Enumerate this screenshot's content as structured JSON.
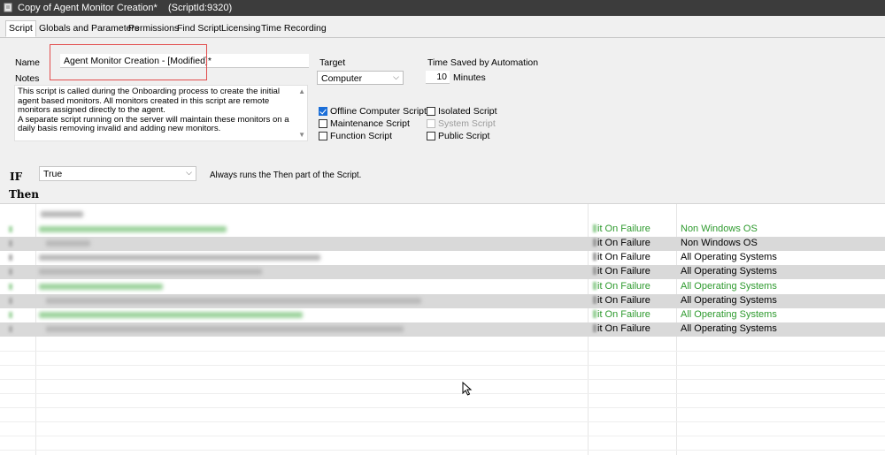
{
  "window": {
    "title": "Copy of Agent Monitor Creation*",
    "script_id": "(ScriptId:9320)"
  },
  "tabs": [
    "Script",
    "Globals and Parameters",
    "Permissions",
    "Find Script",
    "Licensing",
    "Time Recording"
  ],
  "form": {
    "name_label": "Name",
    "name_value": "Agent Monitor Creation - [Modified]*",
    "notes_label": "Notes",
    "notes_value": "This script is called during the Onboarding process to create the initial agent based monitors.  All monitors created in this script are remote monitors assigned directly to the agent.\nA separate script running on the server will maintain these monitors on a daily basis removing invalid and adding new monitors.",
    "target_label": "Target",
    "target_value": "Computer",
    "time_saved_label": "Time Saved by Automation",
    "time_saved_value": "10",
    "time_saved_unit": "Minutes",
    "checkboxes": {
      "offline_computer_script": {
        "label": "Offline Computer Script",
        "checked": true
      },
      "maintenance_script": {
        "label": "Maintenance Script",
        "checked": false
      },
      "function_script": {
        "label": "Function Script",
        "checked": false
      },
      "isolated_script": {
        "label": "Isolated Script",
        "checked": false
      },
      "system_script": {
        "label": "System Script",
        "checked": false,
        "disabled": true
      },
      "public_script": {
        "label": "Public Script",
        "checked": false
      }
    }
  },
  "if_section": {
    "if_label": "IF",
    "condition_value": "True",
    "condition_description": "Always runs the Then part of the Script.",
    "then_label": "Then"
  },
  "steps": [
    {
      "on_failure": "it On Failure",
      "os": "Non Windows OS",
      "color": "green"
    },
    {
      "on_failure": "it On Failure",
      "os": "Non Windows OS",
      "color": "gray"
    },
    {
      "on_failure": "it On Failure",
      "os": "All Operating Systems",
      "color": "normal"
    },
    {
      "on_failure": "it On Failure",
      "os": "All Operating Systems",
      "color": "gray"
    },
    {
      "on_failure": "it On Failure",
      "os": "All Operating Systems",
      "color": "green"
    },
    {
      "on_failure": "it On Failure",
      "os": "All Operating Systems",
      "color": "gray"
    },
    {
      "on_failure": "it On Failure",
      "os": "All Operating Systems",
      "color": "green"
    },
    {
      "on_failure": "it On Failure",
      "os": "All Operating Systems",
      "color": "gray"
    }
  ],
  "colors": {
    "green_text": "#2e9a2e",
    "title_bar": "#3c3c3c",
    "highlight_box": "#e24c4c",
    "checkbox_checked": "#1a6ed8"
  },
  "icons": {
    "title": "script-icon",
    "dropdown": "chevron-down-icon",
    "cursor": "mouse-pointer-icon"
  }
}
